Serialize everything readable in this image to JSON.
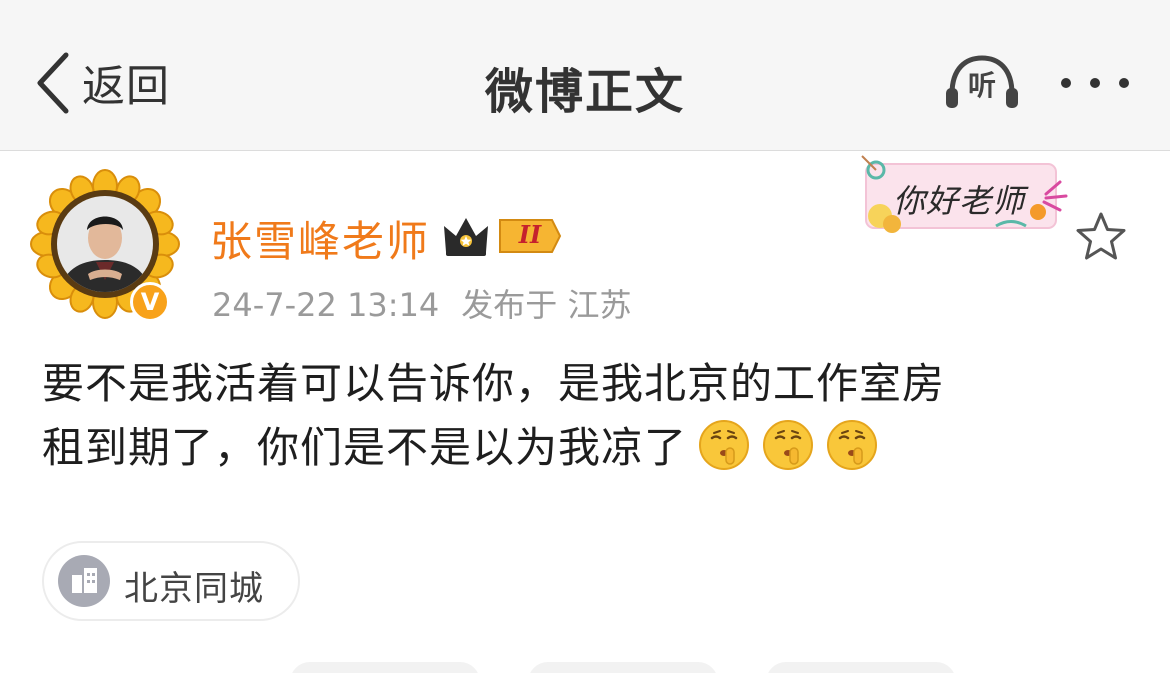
{
  "navbar": {
    "back_label": "返回",
    "title": "微博正文",
    "listen_label": "听",
    "icons": {
      "back": "chevron-left-icon",
      "listen": "headphones-icon",
      "more": "more-dots-icon"
    }
  },
  "post": {
    "author": {
      "name": "张雪峰老师",
      "name_color": "#f07a1a",
      "verified_mark": "V",
      "vip_level": "II"
    },
    "published_time": "24-7-22 13:14",
    "published_location": "发布于 江苏",
    "sticker_text": "你好老师",
    "text_lines": [
      "要不是我活着可以告诉你，是我北京的工作室房",
      "租到期了，你们是不是以为我凉了"
    ],
    "emojis": [
      "shush-emoji",
      "shush-emoji",
      "shush-emoji"
    ],
    "topic": {
      "label": "北京同城",
      "icon": "city-building-icon"
    }
  },
  "colors": {
    "accent_orange": "#f07a1a",
    "text_primary": "#1e1e1e",
    "text_secondary": "#9a9a9a",
    "navbar_bg": "#f6f6f6"
  }
}
